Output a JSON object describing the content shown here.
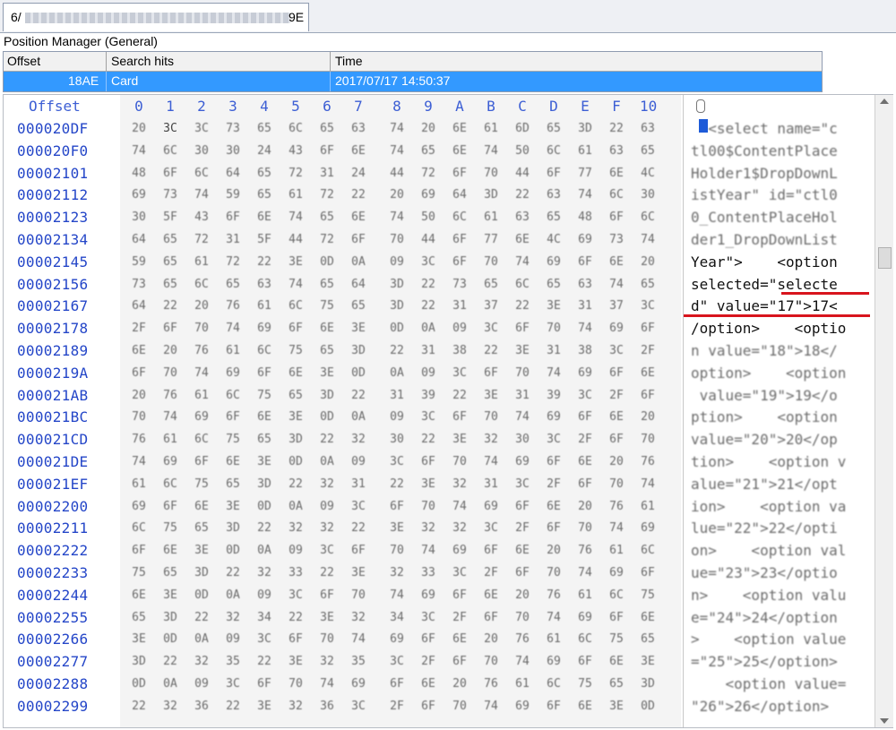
{
  "tab": {
    "label_prefix": "6/",
    "label_suffix": "9E"
  },
  "position_manager": {
    "title": "Position Manager (General)",
    "columns": [
      "Offset",
      "Search hits",
      "Time"
    ],
    "row": {
      "offset": "18AE",
      "hits": "Card",
      "time": "2017/07/17  14:50:37"
    }
  },
  "hex": {
    "offset_header": "Offset",
    "col_numbers": [
      "0",
      "1",
      "2",
      "3",
      "4",
      "5",
      "6",
      "7",
      "8",
      "9",
      "A",
      "B",
      "C",
      "D",
      "E",
      "F",
      "10"
    ],
    "offsets": [
      "000020DF",
      "000020F0",
      "00002101",
      "00002112",
      "00002123",
      "00002134",
      "00002145",
      "00002156",
      "00002167",
      "00002178",
      "00002189",
      "0000219A",
      "000021AB",
      "000021BC",
      "000021CD",
      "000021DE",
      "000021EF",
      "00002200",
      "00002211",
      "00002222",
      "00002233",
      "00002244",
      "00002255",
      "00002266",
      "00002277",
      "00002288",
      "00002299"
    ],
    "rows": [
      [
        "20",
        "3C",
        "3C",
        "73",
        "65",
        "6C",
        "65",
        "63",
        "74",
        "20",
        "6E",
        "61",
        "6D",
        "65",
        "3D",
        "22",
        "63"
      ],
      [
        "74",
        "6C",
        "30",
        "30",
        "24",
        "43",
        "6F",
        "6E",
        "74",
        "65",
        "6E",
        "74",
        "50",
        "6C",
        "61",
        "63",
        "65"
      ],
      [
        "48",
        "6F",
        "6C",
        "64",
        "65",
        "72",
        "31",
        "24",
        "44",
        "72",
        "6F",
        "70",
        "44",
        "6F",
        "77",
        "6E",
        "4C"
      ],
      [
        "69",
        "73",
        "74",
        "59",
        "65",
        "61",
        "72",
        "22",
        "20",
        "69",
        "64",
        "3D",
        "22",
        "63",
        "74",
        "6C",
        "30"
      ],
      [
        "30",
        "5F",
        "43",
        "6F",
        "6E",
        "74",
        "65",
        "6E",
        "74",
        "50",
        "6C",
        "61",
        "63",
        "65",
        "48",
        "6F",
        "6C"
      ],
      [
        "64",
        "65",
        "72",
        "31",
        "5F",
        "44",
        "72",
        "6F",
        "70",
        "44",
        "6F",
        "77",
        "6E",
        "4C",
        "69",
        "73",
        "74"
      ],
      [
        "59",
        "65",
        "61",
        "72",
        "22",
        "3E",
        "0D",
        "0A",
        "09",
        "3C",
        "6F",
        "70",
        "74",
        "69",
        "6F",
        "6E",
        "20"
      ],
      [
        "73",
        "65",
        "6C",
        "65",
        "63",
        "74",
        "65",
        "64",
        "3D",
        "22",
        "73",
        "65",
        "6C",
        "65",
        "63",
        "74",
        "65"
      ],
      [
        "64",
        "22",
        "20",
        "76",
        "61",
        "6C",
        "75",
        "65",
        "3D",
        "22",
        "31",
        "37",
        "22",
        "3E",
        "31",
        "37",
        "3C"
      ],
      [
        "2F",
        "6F",
        "70",
        "74",
        "69",
        "6F",
        "6E",
        "3E",
        "0D",
        "0A",
        "09",
        "3C",
        "6F",
        "70",
        "74",
        "69",
        "6F"
      ],
      [
        "6E",
        "20",
        "76",
        "61",
        "6C",
        "75",
        "65",
        "3D",
        "22",
        "31",
        "38",
        "22",
        "3E",
        "31",
        "38",
        "3C",
        "2F"
      ],
      [
        "6F",
        "70",
        "74",
        "69",
        "6F",
        "6E",
        "3E",
        "0D",
        "0A",
        "09",
        "3C",
        "6F",
        "70",
        "74",
        "69",
        "6F",
        "6E"
      ],
      [
        "20",
        "76",
        "61",
        "6C",
        "75",
        "65",
        "3D",
        "22",
        "31",
        "39",
        "22",
        "3E",
        "31",
        "39",
        "3C",
        "2F",
        "6F"
      ],
      [
        "70",
        "74",
        "69",
        "6F",
        "6E",
        "3E",
        "0D",
        "0A",
        "09",
        "3C",
        "6F",
        "70",
        "74",
        "69",
        "6F",
        "6E",
        "20"
      ],
      [
        "76",
        "61",
        "6C",
        "75",
        "65",
        "3D",
        "22",
        "32",
        "30",
        "22",
        "3E",
        "32",
        "30",
        "3C",
        "2F",
        "6F",
        "70"
      ],
      [
        "74",
        "69",
        "6F",
        "6E",
        "3E",
        "0D",
        "0A",
        "09",
        "3C",
        "6F",
        "70",
        "74",
        "69",
        "6F",
        "6E",
        "20",
        "76"
      ],
      [
        "61",
        "6C",
        "75",
        "65",
        "3D",
        "22",
        "32",
        "31",
        "22",
        "3E",
        "32",
        "31",
        "3C",
        "2F",
        "6F",
        "70",
        "74"
      ],
      [
        "69",
        "6F",
        "6E",
        "3E",
        "0D",
        "0A",
        "09",
        "3C",
        "6F",
        "70",
        "74",
        "69",
        "6F",
        "6E",
        "20",
        "76",
        "61"
      ],
      [
        "6C",
        "75",
        "65",
        "3D",
        "22",
        "32",
        "32",
        "22",
        "3E",
        "32",
        "32",
        "3C",
        "2F",
        "6F",
        "70",
        "74",
        "69"
      ],
      [
        "6F",
        "6E",
        "3E",
        "0D",
        "0A",
        "09",
        "3C",
        "6F",
        "70",
        "74",
        "69",
        "6F",
        "6E",
        "20",
        "76",
        "61",
        "6C"
      ],
      [
        "75",
        "65",
        "3D",
        "22",
        "32",
        "33",
        "22",
        "3E",
        "32",
        "33",
        "3C",
        "2F",
        "6F",
        "70",
        "74",
        "69",
        "6F"
      ],
      [
        "6E",
        "3E",
        "0D",
        "0A",
        "09",
        "3C",
        "6F",
        "70",
        "74",
        "69",
        "6F",
        "6E",
        "20",
        "76",
        "61",
        "6C",
        "75"
      ],
      [
        "65",
        "3D",
        "22",
        "32",
        "34",
        "22",
        "3E",
        "32",
        "34",
        "3C",
        "2F",
        "6F",
        "70",
        "74",
        "69",
        "6F",
        "6E"
      ],
      [
        "3E",
        "0D",
        "0A",
        "09",
        "3C",
        "6F",
        "70",
        "74",
        "69",
        "6F",
        "6E",
        "20",
        "76",
        "61",
        "6C",
        "75",
        "65"
      ],
      [
        "3D",
        "22",
        "32",
        "35",
        "22",
        "3E",
        "32",
        "35",
        "3C",
        "2F",
        "6F",
        "70",
        "74",
        "69",
        "6F",
        "6E",
        "3E"
      ],
      [
        "0D",
        "0A",
        "09",
        "3C",
        "6F",
        "70",
        "74",
        "69",
        "6F",
        "6E",
        "20",
        "76",
        "61",
        "6C",
        "75",
        "65",
        "3D"
      ],
      [
        "22",
        "32",
        "36",
        "22",
        "3E",
        "32",
        "36",
        "3C",
        "2F",
        "6F",
        "70",
        "74",
        "69",
        "6F",
        "6E",
        "3E",
        "0D"
      ]
    ],
    "text_lines": [
      "  <select name=\"c",
      "tl00$ContentPlace",
      "Holder1$DropDownL",
      "istYear\" id=\"ctl0",
      "0_ContentPlaceHol",
      "der1_DropDownList",
      "Year\">    <option ",
      "selected=\"selecte",
      "d\" value=\"17\">17<",
      "/option>    <optio",
      "n value=\"18\">18</",
      "option>    <option",
      " value=\"19\">19</o",
      "ption>    <option ",
      "value=\"20\">20</op",
      "tion>    <option v",
      "alue=\"21\">21</opt",
      "ion>    <option va",
      "lue=\"22\">22</opti",
      "on>    <option val",
      "ue=\"23\">23</optio",
      "n>    <option valu",
      "e=\"24\">24</option",
      ">    <option value",
      "=\"25\">25</option>",
      "    <option value=",
      "\"26\">26</option>"
    ],
    "clear_lines": [
      6,
      7,
      8,
      9
    ]
  },
  "colors": {
    "selection": "#3399ff",
    "offset_blue": "#2446c8",
    "highlight_red": "#d8141d"
  }
}
